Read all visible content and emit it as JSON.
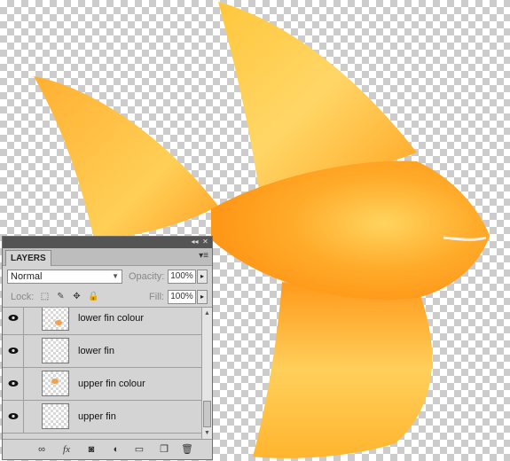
{
  "panel": {
    "tab_label": "LAYERS",
    "collapse_glyph": "◂◂",
    "close_glyph": "✕",
    "menu_glyph": "▾≡",
    "blend_mode": "Normal",
    "opacity_label": "Opacity:",
    "opacity_value": "100%",
    "lock_label": "Lock:",
    "fill_label": "Fill:",
    "fill_value": "100%"
  },
  "layers": [
    {
      "name": "lower fin colour",
      "visible": true,
      "thumb": "lower-fin-colour-thumbnail"
    },
    {
      "name": "lower fin",
      "visible": true,
      "thumb": "lower-fin-thumbnail"
    },
    {
      "name": "upper fin colour",
      "visible": true,
      "thumb": "upper-fin-colour-thumbnail"
    },
    {
      "name": "upper fin",
      "visible": true,
      "thumb": "upper-fin-thumbnail"
    }
  ],
  "bottom_icons": [
    "link-layers-icon",
    "fx-icon",
    "add-mask-icon",
    "adjustment-layer-icon",
    "new-group-icon",
    "new-layer-icon",
    "trash-icon"
  ],
  "colors": {
    "fish_orange": "#ff9c1f",
    "fish_yellow": "#ffd45e",
    "panel_bg": "#d4d4d4"
  }
}
